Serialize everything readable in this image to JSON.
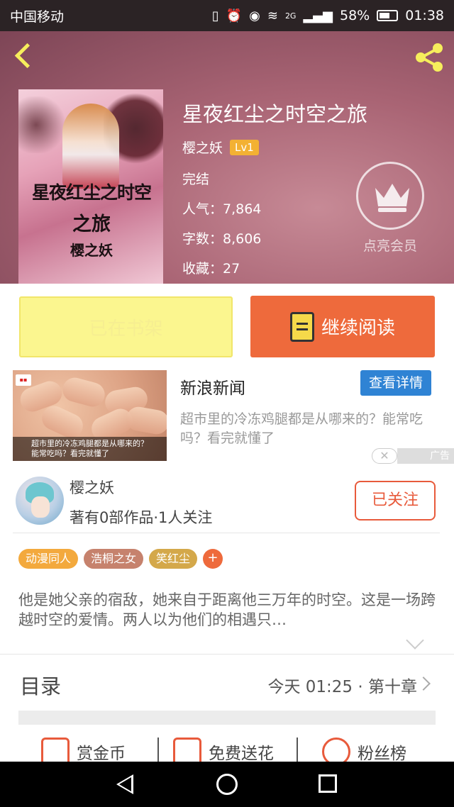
{
  "status_bar": {
    "carrier": "中国移动",
    "network": "2G",
    "battery": "58%",
    "time": "01:38"
  },
  "book": {
    "title": "星夜红尘之时空之旅",
    "author": "樱之妖",
    "level": "Lv1",
    "status": "完结",
    "popularity": "人气：7,864",
    "word_count": "字数：8,606",
    "favorites": "收藏：27",
    "cover_text": [
      "星夜红尘之时空",
      "之旅",
      "樱之妖"
    ]
  },
  "member": {
    "label": "点亮会员"
  },
  "actions": {
    "shelf_label": "已在书架",
    "read_label": "继续阅读"
  },
  "ad": {
    "source": "新浪新闻",
    "detail_label": "查看详情",
    "description": "超市里的冷冻鸡腿都是从哪来的？能常吃吗？看完就懂了",
    "image_caption": "超市里的冷冻鸡腿都是从哪来的？能常吃吗？看完就懂了",
    "close_label": "✕",
    "tag": "广告"
  },
  "author_card": {
    "name": "樱之妖",
    "stats": "著有0部作品·1人关注",
    "follow_label": "已关注"
  },
  "tags": [
    {
      "label": "动漫同人",
      "color": "#f3a93d"
    },
    {
      "label": "浩桐之女",
      "color": "#c6826d"
    },
    {
      "label": "笑红尘",
      "color": "#d4a84a"
    }
  ],
  "tag_add": "+",
  "synopsis": "他是她父亲的宿敌，她来自于距离他三万年的时空。这是一场跨越时空的爱情。两人以为他们的相遇只…",
  "toc": {
    "label": "目录",
    "latest": "今天 01:25 · 第十章"
  },
  "rewards": [
    {
      "label": "赏金币"
    },
    {
      "label": "免费送花"
    },
    {
      "label": "粉丝榜"
    }
  ],
  "colors": {
    "accent": "#ee6a3c",
    "shelf_yellow": "#fbf68f",
    "ad_blue": "#2f83d4"
  }
}
